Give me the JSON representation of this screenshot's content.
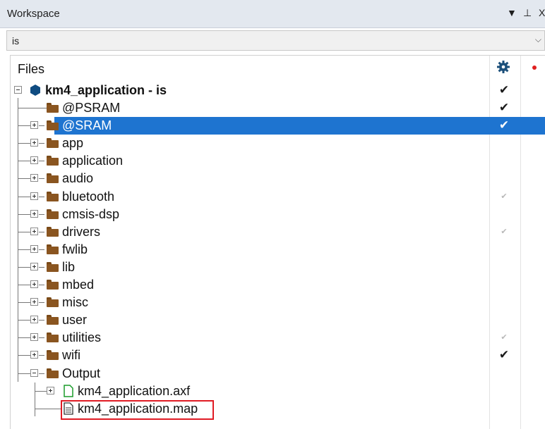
{
  "window": {
    "title": "Workspace",
    "controls": [
      "▼",
      "⊥",
      "X"
    ]
  },
  "config": {
    "value": "is"
  },
  "tree": {
    "header": "Files",
    "root": {
      "label": "km4_application - is",
      "checked": "strong"
    },
    "items": [
      {
        "label": "@PSRAM",
        "expandable": false,
        "check": "strong",
        "selected": false
      },
      {
        "label": "@SRAM",
        "expandable": true,
        "check": "strong",
        "selected": true
      },
      {
        "label": "app",
        "expandable": true,
        "check": "none",
        "selected": false
      },
      {
        "label": "application",
        "expandable": true,
        "check": "none",
        "selected": false
      },
      {
        "label": "audio",
        "expandable": true,
        "check": "none",
        "selected": false
      },
      {
        "label": "bluetooth",
        "expandable": true,
        "check": "faint",
        "selected": false
      },
      {
        "label": "cmsis-dsp",
        "expandable": true,
        "check": "none",
        "selected": false
      },
      {
        "label": "drivers",
        "expandable": true,
        "check": "faint",
        "selected": false
      },
      {
        "label": "fwlib",
        "expandable": true,
        "check": "none",
        "selected": false
      },
      {
        "label": "lib",
        "expandable": true,
        "check": "none",
        "selected": false
      },
      {
        "label": "mbed",
        "expandable": true,
        "check": "none",
        "selected": false
      },
      {
        "label": "misc",
        "expandable": true,
        "check": "none",
        "selected": false
      },
      {
        "label": "user",
        "expandable": true,
        "check": "none",
        "selected": false
      },
      {
        "label": "utilities",
        "expandable": true,
        "check": "faint",
        "selected": false
      },
      {
        "label": "wifi",
        "expandable": true,
        "check": "strong",
        "selected": false
      },
      {
        "label": "Output",
        "expandable": true,
        "expanded": true,
        "check": "none",
        "selected": false
      }
    ],
    "output_children": [
      {
        "label": "km4_application.axf",
        "icon": "file-green-icon",
        "expandable": true
      },
      {
        "label": "km4_application.map",
        "icon": "document-icon",
        "expandable": false,
        "highlighted": true
      }
    ],
    "check_glyph": "✔"
  },
  "colors": {
    "selection": "#1e74d0",
    "highlight_box": "#e01b24",
    "folder": "#8a5520"
  }
}
